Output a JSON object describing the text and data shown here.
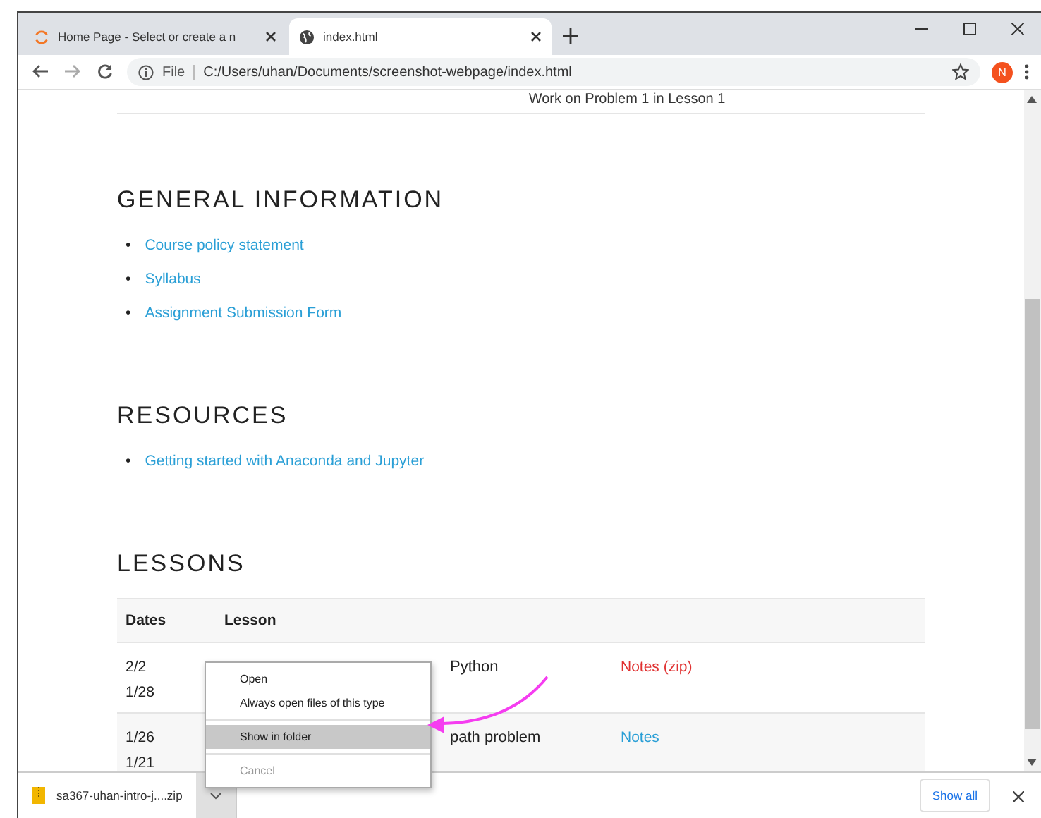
{
  "tabs": [
    {
      "title": "Home Page - Select or create a n",
      "selected": false
    },
    {
      "title": "index.html",
      "selected": true
    }
  ],
  "address_bar": {
    "scheme": "File",
    "url": "C:/Users/uhan/Documents/screenshot-webpage/index.html"
  },
  "profile": {
    "initial": "N"
  },
  "page": {
    "cut_top_text": "Work on Problem 1 in Lesson 1",
    "sections": [
      {
        "heading": "GENERAL INFORMATION",
        "links": [
          {
            "bullet": "•",
            "text": "Course policy statement"
          },
          {
            "bullet": "•",
            "text": "Syllabus"
          },
          {
            "bullet": "•",
            "text": "Assignment Submission Form"
          }
        ]
      },
      {
        "heading": "RESOURCES",
        "links": [
          {
            "bullet": "•",
            "text": "Getting started with Anaconda and Jupyter"
          }
        ]
      }
    ],
    "lessons": {
      "heading": "LESSONS",
      "columns": [
        "Dates",
        "Lesson"
      ],
      "rows": [
        {
          "dates": [
            "2/2",
            "1/28"
          ],
          "lesson": "Python",
          "notes": "Notes (zip)",
          "color": "#e03131"
        },
        {
          "dates": [
            "1/26",
            "1/21"
          ],
          "lesson": "path problem",
          "notes": "Notes",
          "color": "#2a9fd6"
        }
      ]
    }
  },
  "context_menu": [
    {
      "label": "Open",
      "selected": false,
      "disabled": false,
      "separator_before": false
    },
    {
      "label": "Always open files of this type",
      "selected": false,
      "disabled": false,
      "separator_before": false
    },
    {
      "label": "Show in folder",
      "selected": true,
      "disabled": false,
      "separator_before": true
    },
    {
      "label": "Cancel",
      "selected": false,
      "disabled": true,
      "separator_before": true
    }
  ],
  "download_bar": {
    "file": "sa367-uhan-intro-j....zip",
    "show_all": "Show all"
  }
}
